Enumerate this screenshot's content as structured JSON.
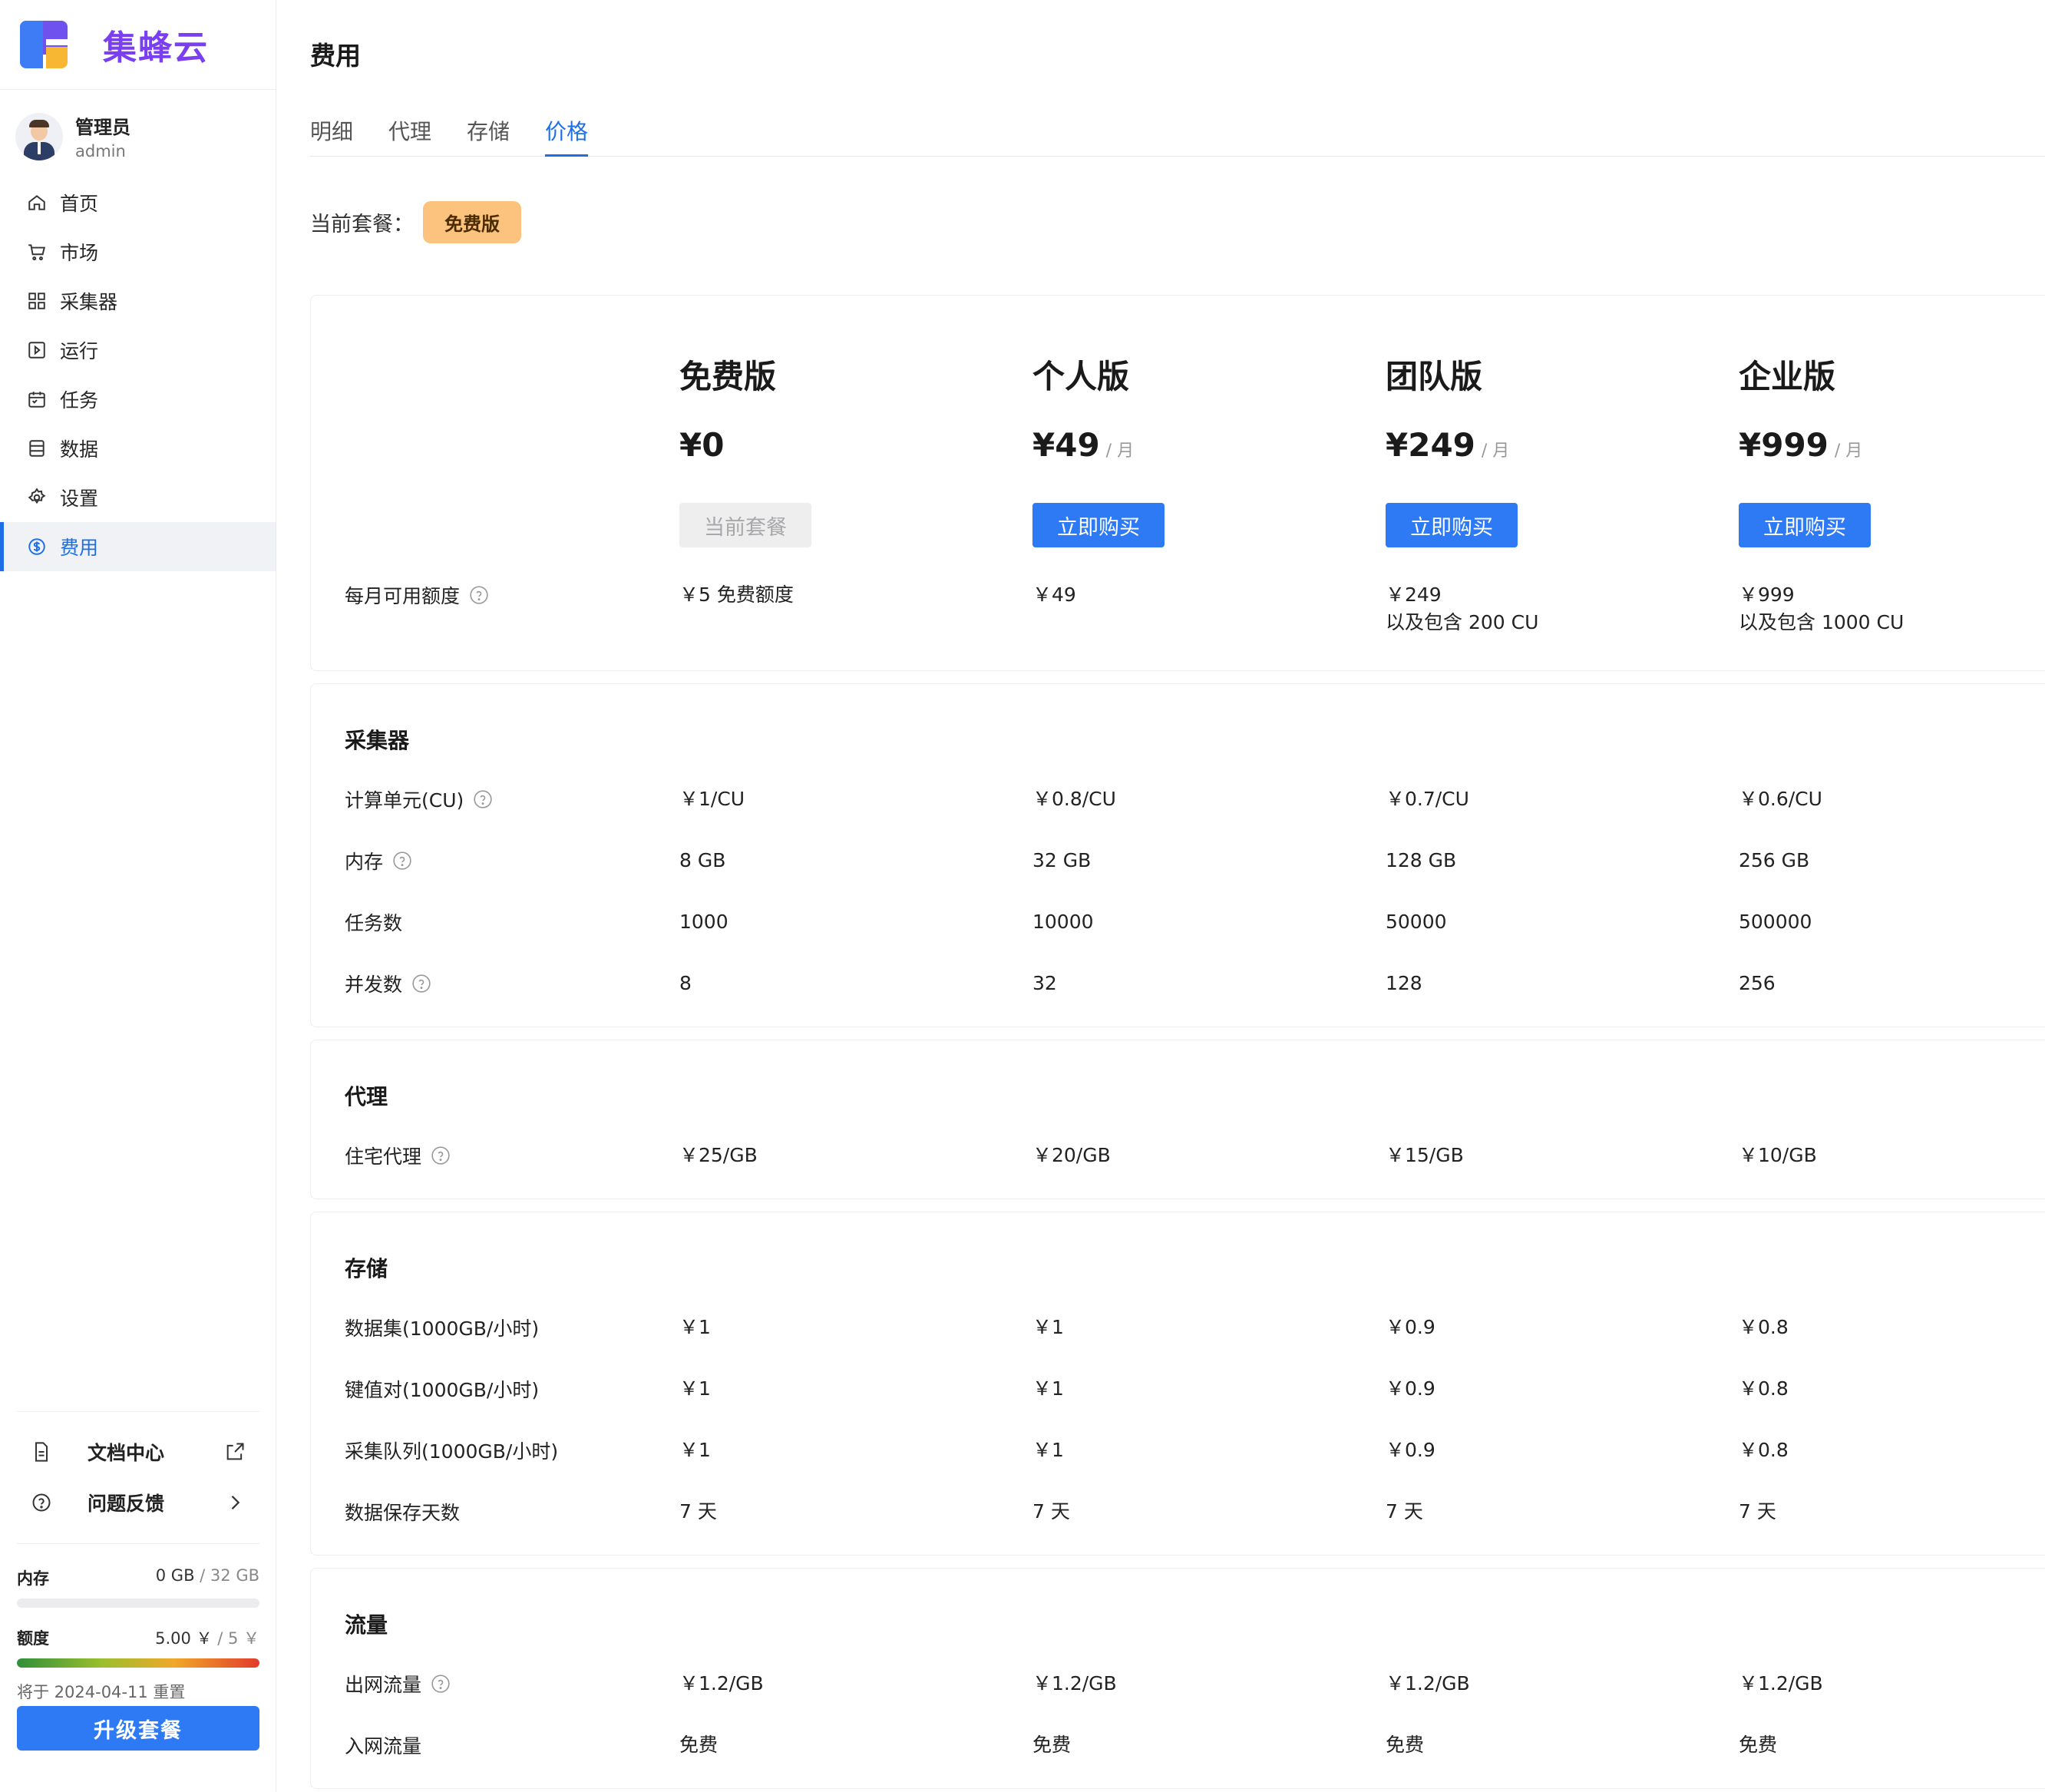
{
  "app": {
    "brand": "集蜂云"
  },
  "user": {
    "name": "管理员",
    "account": "admin"
  },
  "nav": [
    {
      "label": "首页",
      "icon": "home-icon"
    },
    {
      "label": "市场",
      "icon": "cart-icon"
    },
    {
      "label": "采集器",
      "icon": "grid-icon"
    },
    {
      "label": "运行",
      "icon": "play-box-icon"
    },
    {
      "label": "任务",
      "icon": "calendar-icon"
    },
    {
      "label": "数据",
      "icon": "database-icon"
    },
    {
      "label": "设置",
      "icon": "gear-icon"
    },
    {
      "label": "费用",
      "icon": "dollar-circle-icon",
      "active": true
    }
  ],
  "links": {
    "docs": "文档中心",
    "feedback": "问题反馈"
  },
  "usage": {
    "memory_label": "内存",
    "memory_used": "0 GB",
    "memory_total": "/ 32 GB",
    "memory_fraction": 0,
    "quota_label": "额度",
    "quota_used": "5.00 ￥",
    "quota_total": "/ 5 ￥",
    "quota_fraction": 1,
    "reset_text": "将于 2024-04-11 重置",
    "upgrade_label": "升级套餐"
  },
  "page": {
    "title": "费用",
    "tabs": [
      "明细",
      "代理",
      "存储",
      "价格"
    ],
    "active_tab": "价格",
    "current_plan_label": "当前套餐：",
    "current_plan": "免费版"
  },
  "plans": [
    {
      "name": "免费版",
      "price": "¥0",
      "per": "",
      "button": "当前套餐",
      "quota_line1": "￥5 免费额度",
      "quota_line2": ""
    },
    {
      "name": "个人版",
      "price": "¥49",
      "per": "/ 月",
      "button": "立即购买",
      "quota_line1": "￥49",
      "quota_line2": ""
    },
    {
      "name": "团队版",
      "price": "¥249",
      "per": "/ 月",
      "button": "立即购买",
      "quota_line1": "￥249",
      "quota_line2": "以及包含 200 CU"
    },
    {
      "name": "企业版",
      "price": "¥999",
      "per": "/ 月",
      "button": "立即购买",
      "quota_line1": "￥999",
      "quota_line2": "以及包含 1000 CU"
    }
  ],
  "quota_row_label": "每月可用额度",
  "sections": {
    "collector": {
      "title": "采集器",
      "rows": [
        {
          "label": "计算单元(CU)",
          "help": true,
          "values": [
            "￥1/CU",
            "￥0.8/CU",
            "￥0.7/CU",
            "￥0.6/CU"
          ]
        },
        {
          "label": "内存",
          "help": true,
          "values": [
            "8 GB",
            "32 GB",
            "128 GB",
            "256 GB"
          ]
        },
        {
          "label": "任务数",
          "help": false,
          "values": [
            "1000",
            "10000",
            "50000",
            "500000"
          ]
        },
        {
          "label": "并发数",
          "help": true,
          "values": [
            "8",
            "32",
            "128",
            "256"
          ]
        }
      ]
    },
    "proxy": {
      "title": "代理",
      "rows": [
        {
          "label": "住宅代理",
          "help": true,
          "values": [
            "￥25/GB",
            "￥20/GB",
            "￥15/GB",
            "￥10/GB"
          ]
        }
      ]
    },
    "storage": {
      "title": "存储",
      "rows": [
        {
          "label": "数据集(1000GB/小时)",
          "help": false,
          "values": [
            "￥1",
            "￥1",
            "￥0.9",
            "￥0.8"
          ]
        },
        {
          "label": "键值对(1000GB/小时)",
          "help": false,
          "values": [
            "￥1",
            "￥1",
            "￥0.9",
            "￥0.8"
          ]
        },
        {
          "label": "采集队列(1000GB/小时)",
          "help": false,
          "values": [
            "￥1",
            "￥1",
            "￥0.9",
            "￥0.8"
          ]
        },
        {
          "label": "数据保存天数",
          "help": false,
          "values": [
            "7 天",
            "7 天",
            "7 天",
            "7 天"
          ]
        }
      ]
    },
    "traffic": {
      "title": "流量",
      "rows": [
        {
          "label": "出网流量",
          "help": true,
          "values": [
            "￥1.2/GB",
            "￥1.2/GB",
            "￥1.2/GB",
            "￥1.2/GB"
          ]
        },
        {
          "label": "入网流量",
          "help": false,
          "values": [
            "免费",
            "免费",
            "免费",
            "免费"
          ]
        }
      ]
    }
  },
  "colors": {
    "accent": "#2e7af5",
    "brand": "#7b3ff2",
    "badge": "#fbc37d"
  }
}
